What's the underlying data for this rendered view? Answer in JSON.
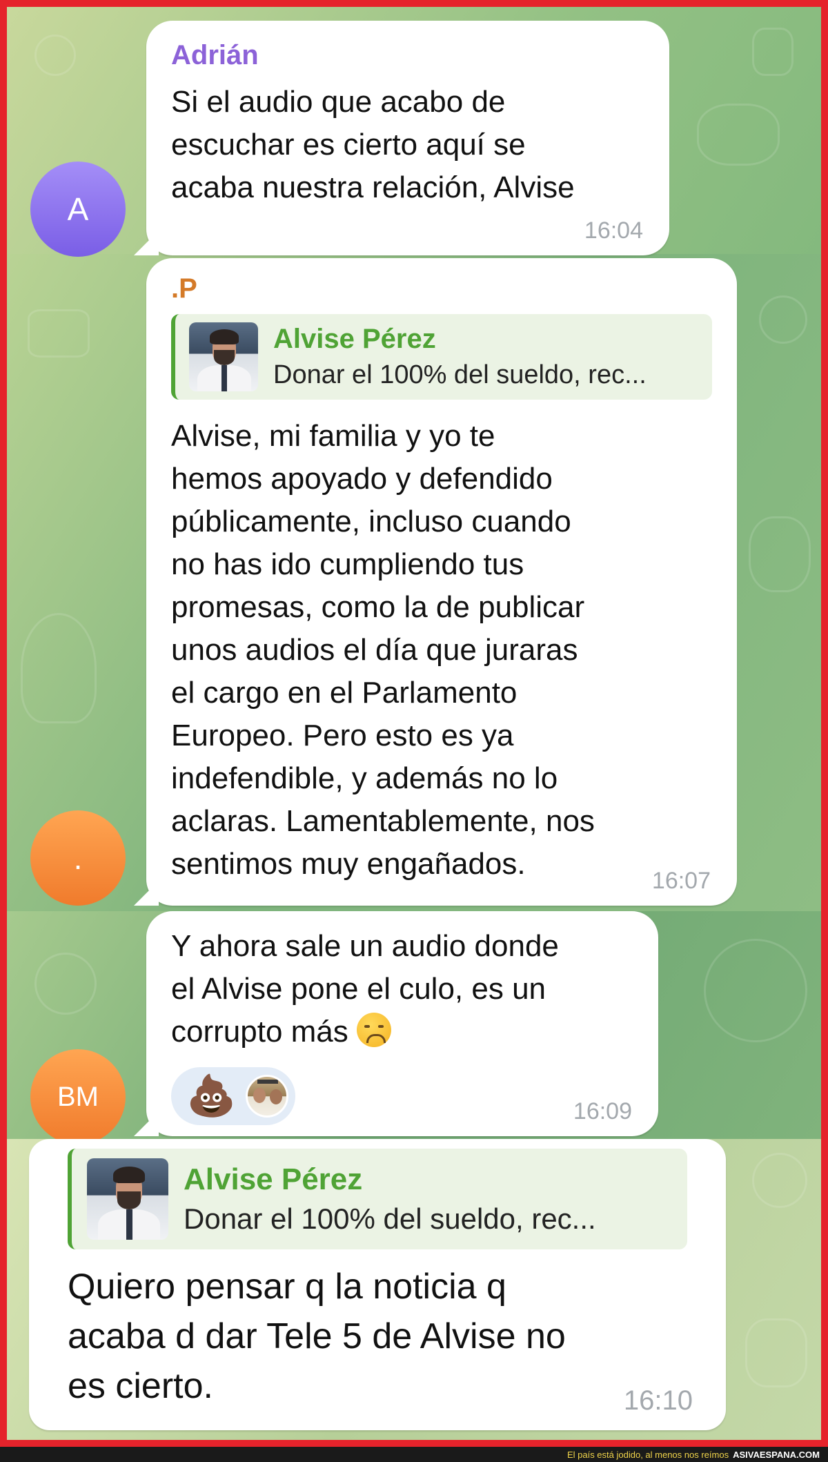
{
  "messages": [
    {
      "sender": "Adrián",
      "avatar_initials": "A",
      "text": "Si el audio que acabo de\nescuchar es cierto aquí se\nacaba nuestra relación, Alvise",
      "time": "16:04",
      "name_color": "#8c62d8",
      "avatar_color": "#8f76ef"
    },
    {
      "sender": ".P",
      "avatar_initials": ".",
      "reply": {
        "name": "Alvise Pérez",
        "snippet": "Donar el 100% del sueldo, rec..."
      },
      "text": "Alvise, mi familia y yo te\nhemos apoyado y defendido\npúblicamente, incluso cuando\nno has ido cumpliendo tus\npromesas, como la de publicar\nunos audios el día que juraras\nel cargo en el Parlamento\nEuropeo. Pero esto es ya\nindefendible, y además no lo\naclaras. Lamentablemente, nos\nsentimos muy engañados.",
      "time": "16:07",
      "name_color": "#d47a28",
      "avatar_color": "#f58c3a"
    },
    {
      "avatar_initials": "BM",
      "text": "Y ahora sale un audio donde\nel Alvise pone el culo, es un\ncorrupto más",
      "emoji": "disappointed-face",
      "reactions": [
        "💩"
      ],
      "time": "16:09",
      "avatar_color": "#f58c3a"
    },
    {
      "reply": {
        "name": "Alvise Pérez",
        "snippet": "Donar el 100% del sueldo, rec..."
      },
      "text": "Quiero pensar q la noticia q\nacaba d dar Tele 5 de Alvise no\nes cierto.",
      "time": "16:10"
    }
  ],
  "footer": {
    "tagline": "El país está jodido, al menos nos reímos",
    "site": "ASIVAESPANA.COM"
  },
  "colors": {
    "frame_border": "#e5232b",
    "reply_accent": "#4fa335",
    "bubble": "#ffffff"
  }
}
